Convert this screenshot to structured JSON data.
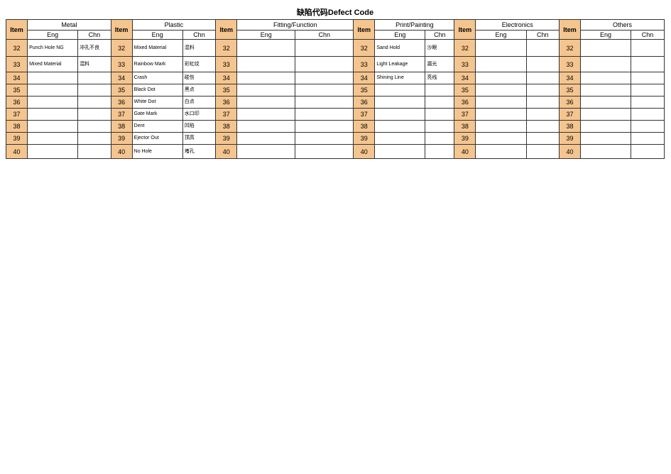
{
  "title": "缺陷代码Defect Code",
  "header": {
    "item": "Item",
    "eng": "Eng",
    "chn": "Chn",
    "groups": [
      "Metal",
      "Plastic",
      "Fitting/Function",
      "Print/Painting",
      "Electronics",
      "Others"
    ]
  },
  "rows": [
    {
      "n": "32",
      "metal": {
        "eng": "Punch Hole NG",
        "chn": "冲孔不良"
      },
      "plastic": {
        "eng": "Mixed Material",
        "chn": "混料"
      },
      "print": {
        "eng": "Sand Hold",
        "chn": "沙眼"
      }
    },
    {
      "n": "33",
      "metal": {
        "eng": "Mixed Material",
        "chn": "混料"
      },
      "plastic": {
        "eng": "Rainbow Mark",
        "chn": "彩虹纹"
      },
      "print": {
        "eng": "Light Leakage",
        "chn": "漏光"
      }
    },
    {
      "n": "34",
      "plastic": {
        "eng": "Crash",
        "chn": "碰伤"
      },
      "print": {
        "eng": "Shining Line",
        "chn": "亮线"
      }
    },
    {
      "n": "35",
      "plastic": {
        "eng": "Black Dot",
        "chn": "黑点"
      }
    },
    {
      "n": "36",
      "plastic": {
        "eng": "White Dot",
        "chn": "白点"
      }
    },
    {
      "n": "37",
      "plastic": {
        "eng": "Gate Mark",
        "chn": "水口印"
      }
    },
    {
      "n": "38",
      "plastic": {
        "eng": "Dent",
        "chn": "凹陷"
      }
    },
    {
      "n": "39",
      "plastic": {
        "eng": "Ejector Out",
        "chn": "顶高"
      }
    },
    {
      "n": "40",
      "plastic": {
        "eng": "No Hole",
        "chn": "堵孔"
      }
    }
  ]
}
